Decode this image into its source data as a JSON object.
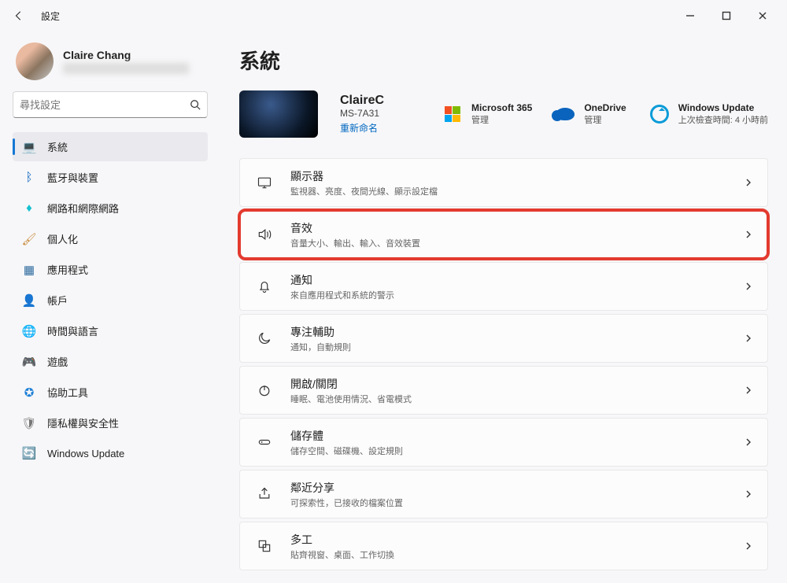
{
  "window": {
    "title": "設定"
  },
  "profile": {
    "name": "Claire Chang"
  },
  "search": {
    "placeholder": "尋找設定"
  },
  "nav": {
    "items": [
      {
        "id": "system",
        "label": "系統",
        "icon": "💻",
        "active": true
      },
      {
        "id": "bluetooth",
        "label": "藍牙與裝置",
        "icon": "ᛒ"
      },
      {
        "id": "network",
        "label": "網路和網際網路",
        "icon": "♦"
      },
      {
        "id": "personal",
        "label": "個人化",
        "icon": "🖌"
      },
      {
        "id": "apps",
        "label": "應用程式",
        "icon": "▦"
      },
      {
        "id": "accounts",
        "label": "帳戶",
        "icon": "👤"
      },
      {
        "id": "time",
        "label": "時間與語言",
        "icon": "🌐"
      },
      {
        "id": "gaming",
        "label": "遊戲",
        "icon": "🎮"
      },
      {
        "id": "access",
        "label": "協助工具",
        "icon": "✪"
      },
      {
        "id": "privacy",
        "label": "隱私權與安全性",
        "icon": "🛡"
      },
      {
        "id": "update",
        "label": "Windows Update",
        "icon": "🔄"
      }
    ]
  },
  "main": {
    "heading": "系統",
    "pc": {
      "device_name": "ClaireC",
      "model": "MS-7A31",
      "rename": "重新命名"
    },
    "status": {
      "m365": {
        "title": "Microsoft 365",
        "sub": "管理"
      },
      "onedrive": {
        "title": "OneDrive",
        "sub": "管理"
      },
      "update": {
        "title": "Windows Update",
        "sub": "上次檢查時間: 4 小時前"
      }
    },
    "cards": [
      {
        "id": "display",
        "title": "顯示器",
        "sub": "監視器、亮度、夜間光線、顯示設定檔",
        "icon": "monitor"
      },
      {
        "id": "sound",
        "title": "音效",
        "sub": "音量大小、輸出、輸入、音效裝置",
        "icon": "sound",
        "highlight": true
      },
      {
        "id": "notify",
        "title": "通知",
        "sub": "來自應用程式和系統的警示",
        "icon": "bell"
      },
      {
        "id": "focus",
        "title": "專注輔助",
        "sub": "通知，自動規則",
        "icon": "moon"
      },
      {
        "id": "power",
        "title": "開啟/關閉",
        "sub": "睡眠、電池使用情況、省電模式",
        "icon": "power"
      },
      {
        "id": "storage",
        "title": "儲存體",
        "sub": "儲存空間、磁碟機、設定規則",
        "icon": "storage"
      },
      {
        "id": "share",
        "title": "鄰近分享",
        "sub": "可探索性，已接收的檔案位置",
        "icon": "share"
      },
      {
        "id": "multi",
        "title": "多工",
        "sub": "貼齊視窗、桌面、工作切換",
        "icon": "multi"
      }
    ]
  },
  "nav_colors": {
    "system": "#1e7fd6",
    "bluetooth": "#0a64bd",
    "network": "#15c0d0",
    "personal": "#c78a3a",
    "apps": "#2e6b9e",
    "accounts": "#3aa05f",
    "time": "#2e6b9e",
    "gaming": "#666",
    "access": "#1e7fd6",
    "privacy": "#777",
    "update": "#16a0d7"
  }
}
